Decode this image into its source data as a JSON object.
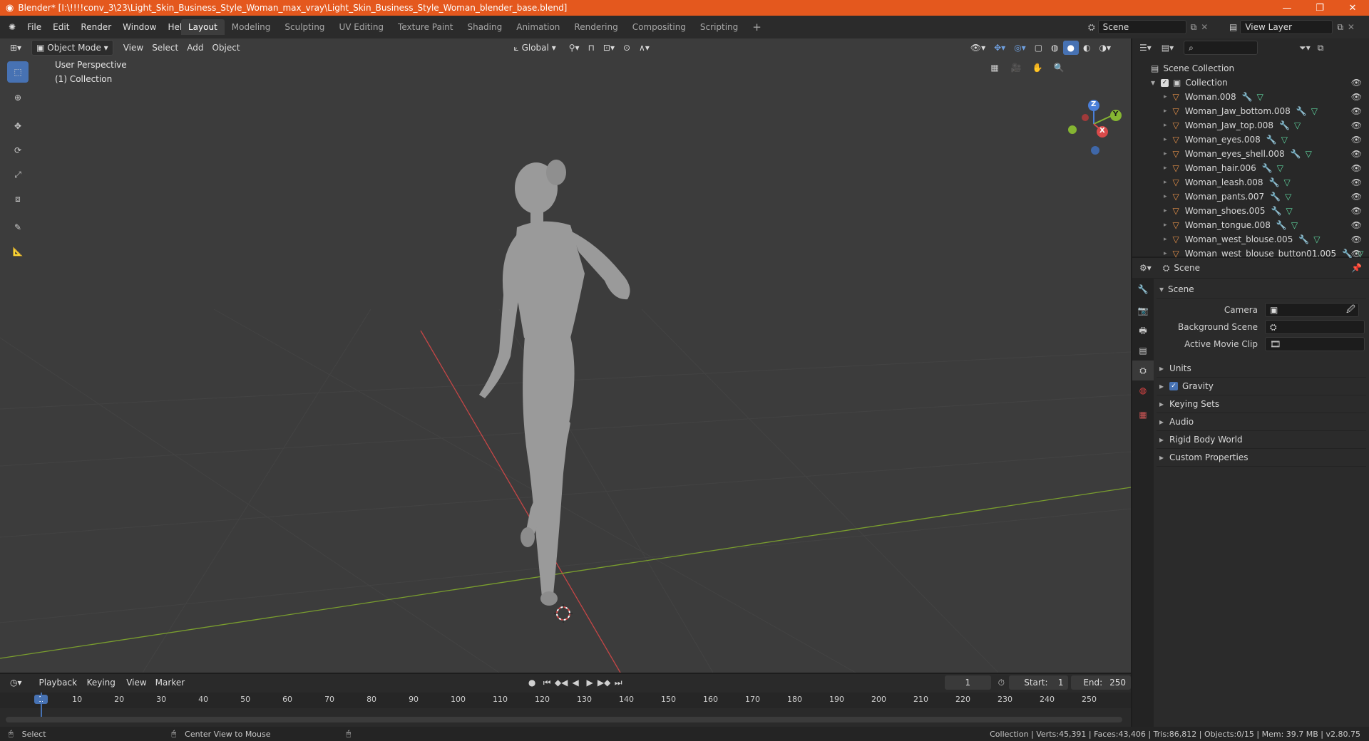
{
  "title_bar": {
    "title": "Blender* [I:\\!!!!conv_3\\23\\Light_Skin_Business_Style_Woman_max_vray\\Light_Skin_Business_Style_Woman_blender_base.blend]",
    "minimize": "—",
    "restore": "❐",
    "close": "✕"
  },
  "menu": {
    "items": [
      "File",
      "Edit",
      "Render",
      "Window",
      "Help"
    ]
  },
  "workspaces": {
    "tabs": [
      "Layout",
      "Modeling",
      "Sculpting",
      "UV Editing",
      "Texture Paint",
      "Shading",
      "Animation",
      "Rendering",
      "Compositing",
      "Scripting"
    ],
    "active": "Layout",
    "add": "+"
  },
  "scene_selector": {
    "value": "Scene"
  },
  "view_layer_selector": {
    "value": "View Layer"
  },
  "viewport_header": {
    "mode": "Object Mode",
    "menus": [
      "View",
      "Select",
      "Add",
      "Object"
    ],
    "orientation": "Global"
  },
  "viewport": {
    "perspective_label": "User Perspective",
    "collection_label": "(1) Collection",
    "gizmo": {
      "z": "Z",
      "y": "Y",
      "x": "X"
    }
  },
  "outliner": {
    "root": "Scene Collection",
    "collection": "Collection",
    "items": [
      "Woman.008",
      "Woman_Jaw_bottom.008",
      "Woman_Jaw_top.008",
      "Woman_eyes.008",
      "Woman_eyes_shell.008",
      "Woman_hair.006",
      "Woman_leash.008",
      "Woman_pants.007",
      "Woman_shoes.005",
      "Woman_tongue.008",
      "Woman_west_blouse.005",
      "Woman_west_blouse_button01.005"
    ]
  },
  "properties": {
    "context": "Scene",
    "panel": "Scene",
    "fields": [
      {
        "label": "Camera"
      },
      {
        "label": "Background Scene"
      },
      {
        "label": "Active Movie Clip"
      }
    ],
    "sections": [
      "Units",
      "Gravity",
      "Keying Sets",
      "Audio",
      "Rigid Body World",
      "Custom Properties"
    ],
    "gravity_checked": true
  },
  "timeline": {
    "menus": [
      "Playback",
      "Keying",
      "View",
      "Marker"
    ],
    "current_frame": "1",
    "start_label": "Start:",
    "start": "1",
    "end_label": "End:",
    "end": "250",
    "ruler": [
      "1",
      "10",
      "20",
      "30",
      "40",
      "50",
      "60",
      "70",
      "80",
      "90",
      "100",
      "110",
      "120",
      "130",
      "140",
      "150",
      "160",
      "170",
      "180",
      "190",
      "200",
      "210",
      "220",
      "230",
      "240",
      "250"
    ]
  },
  "status_bar": {
    "select": "Select",
    "center_view": "Center View to Mouse",
    "stats": "Collection | Verts:45,391 | Faces:43,406 | Tris:86,812 | Objects:0/15 | Mem: 39.7 MB | v2.80.75"
  },
  "colors": {
    "title_bar": "#e4581e",
    "accent": "#4772b3",
    "x_axis": "#d94a4a",
    "y_axis": "#85b532",
    "z_axis": "#4a7fd9",
    "object_icon": "#e8924a"
  }
}
